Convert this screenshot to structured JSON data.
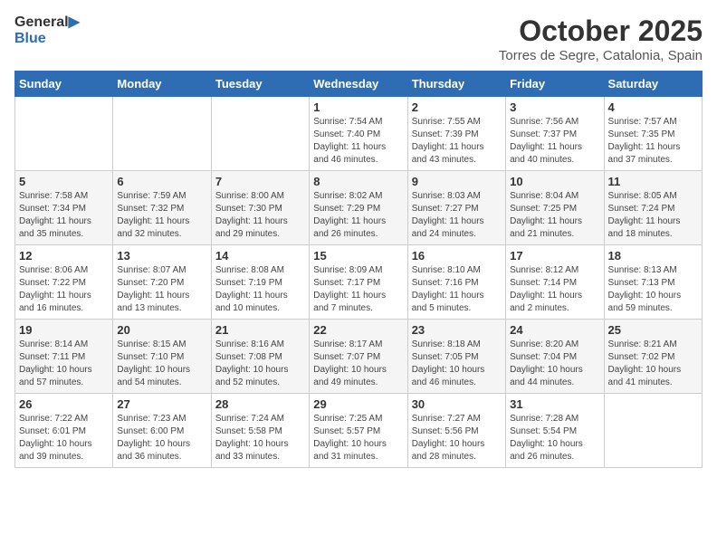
{
  "header": {
    "logo_general": "General",
    "logo_blue": "Blue",
    "month": "October 2025",
    "location": "Torres de Segre, Catalonia, Spain"
  },
  "calendar": {
    "days_of_week": [
      "Sunday",
      "Monday",
      "Tuesday",
      "Wednesday",
      "Thursday",
      "Friday",
      "Saturday"
    ],
    "weeks": [
      [
        {
          "day": "",
          "info": ""
        },
        {
          "day": "",
          "info": ""
        },
        {
          "day": "",
          "info": ""
        },
        {
          "day": "1",
          "info": "Sunrise: 7:54 AM\nSunset: 7:40 PM\nDaylight: 11 hours\nand 46 minutes."
        },
        {
          "day": "2",
          "info": "Sunrise: 7:55 AM\nSunset: 7:39 PM\nDaylight: 11 hours\nand 43 minutes."
        },
        {
          "day": "3",
          "info": "Sunrise: 7:56 AM\nSunset: 7:37 PM\nDaylight: 11 hours\nand 40 minutes."
        },
        {
          "day": "4",
          "info": "Sunrise: 7:57 AM\nSunset: 7:35 PM\nDaylight: 11 hours\nand 37 minutes."
        }
      ],
      [
        {
          "day": "5",
          "info": "Sunrise: 7:58 AM\nSunset: 7:34 PM\nDaylight: 11 hours\nand 35 minutes."
        },
        {
          "day": "6",
          "info": "Sunrise: 7:59 AM\nSunset: 7:32 PM\nDaylight: 11 hours\nand 32 minutes."
        },
        {
          "day": "7",
          "info": "Sunrise: 8:00 AM\nSunset: 7:30 PM\nDaylight: 11 hours\nand 29 minutes."
        },
        {
          "day": "8",
          "info": "Sunrise: 8:02 AM\nSunset: 7:29 PM\nDaylight: 11 hours\nand 26 minutes."
        },
        {
          "day": "9",
          "info": "Sunrise: 8:03 AM\nSunset: 7:27 PM\nDaylight: 11 hours\nand 24 minutes."
        },
        {
          "day": "10",
          "info": "Sunrise: 8:04 AM\nSunset: 7:25 PM\nDaylight: 11 hours\nand 21 minutes."
        },
        {
          "day": "11",
          "info": "Sunrise: 8:05 AM\nSunset: 7:24 PM\nDaylight: 11 hours\nand 18 minutes."
        }
      ],
      [
        {
          "day": "12",
          "info": "Sunrise: 8:06 AM\nSunset: 7:22 PM\nDaylight: 11 hours\nand 16 minutes."
        },
        {
          "day": "13",
          "info": "Sunrise: 8:07 AM\nSunset: 7:20 PM\nDaylight: 11 hours\nand 13 minutes."
        },
        {
          "day": "14",
          "info": "Sunrise: 8:08 AM\nSunset: 7:19 PM\nDaylight: 11 hours\nand 10 minutes."
        },
        {
          "day": "15",
          "info": "Sunrise: 8:09 AM\nSunset: 7:17 PM\nDaylight: 11 hours\nand 7 minutes."
        },
        {
          "day": "16",
          "info": "Sunrise: 8:10 AM\nSunset: 7:16 PM\nDaylight: 11 hours\nand 5 minutes."
        },
        {
          "day": "17",
          "info": "Sunrise: 8:12 AM\nSunset: 7:14 PM\nDaylight: 11 hours\nand 2 minutes."
        },
        {
          "day": "18",
          "info": "Sunrise: 8:13 AM\nSunset: 7:13 PM\nDaylight: 10 hours\nand 59 minutes."
        }
      ],
      [
        {
          "day": "19",
          "info": "Sunrise: 8:14 AM\nSunset: 7:11 PM\nDaylight: 10 hours\nand 57 minutes."
        },
        {
          "day": "20",
          "info": "Sunrise: 8:15 AM\nSunset: 7:10 PM\nDaylight: 10 hours\nand 54 minutes."
        },
        {
          "day": "21",
          "info": "Sunrise: 8:16 AM\nSunset: 7:08 PM\nDaylight: 10 hours\nand 52 minutes."
        },
        {
          "day": "22",
          "info": "Sunrise: 8:17 AM\nSunset: 7:07 PM\nDaylight: 10 hours\nand 49 minutes."
        },
        {
          "day": "23",
          "info": "Sunrise: 8:18 AM\nSunset: 7:05 PM\nDaylight: 10 hours\nand 46 minutes."
        },
        {
          "day": "24",
          "info": "Sunrise: 8:20 AM\nSunset: 7:04 PM\nDaylight: 10 hours\nand 44 minutes."
        },
        {
          "day": "25",
          "info": "Sunrise: 8:21 AM\nSunset: 7:02 PM\nDaylight: 10 hours\nand 41 minutes."
        }
      ],
      [
        {
          "day": "26",
          "info": "Sunrise: 7:22 AM\nSunset: 6:01 PM\nDaylight: 10 hours\nand 39 minutes."
        },
        {
          "day": "27",
          "info": "Sunrise: 7:23 AM\nSunset: 6:00 PM\nDaylight: 10 hours\nand 36 minutes."
        },
        {
          "day": "28",
          "info": "Sunrise: 7:24 AM\nSunset: 5:58 PM\nDaylight: 10 hours\nand 33 minutes."
        },
        {
          "day": "29",
          "info": "Sunrise: 7:25 AM\nSunset: 5:57 PM\nDaylight: 10 hours\nand 31 minutes."
        },
        {
          "day": "30",
          "info": "Sunrise: 7:27 AM\nSunset: 5:56 PM\nDaylight: 10 hours\nand 28 minutes."
        },
        {
          "day": "31",
          "info": "Sunrise: 7:28 AM\nSunset: 5:54 PM\nDaylight: 10 hours\nand 26 minutes."
        },
        {
          "day": "",
          "info": ""
        }
      ]
    ]
  }
}
